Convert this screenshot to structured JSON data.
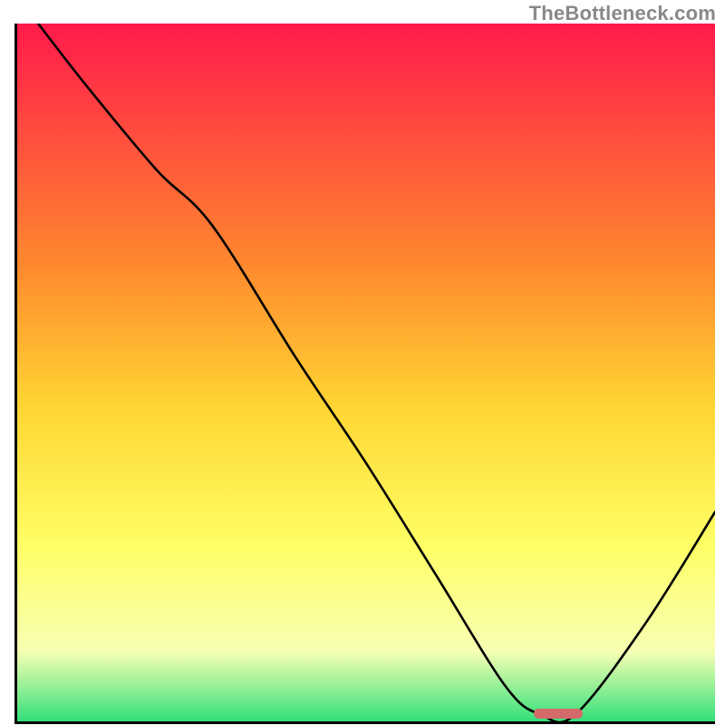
{
  "watermark": "TheBottleneck.com",
  "colors": {
    "gradient_top": "#ff1a4b",
    "gradient_mid1": "#ff8a2e",
    "gradient_mid2": "#ffd633",
    "gradient_mid3": "#ffff66",
    "gradient_mid4": "#f7ffb3",
    "gradient_bottom": "#33e07a",
    "axis": "#000000",
    "curve": "#000000",
    "marker": "#d46a6a"
  },
  "chart_data": {
    "type": "line",
    "title": "",
    "xlabel": "",
    "ylabel": "",
    "xlim": [
      0,
      100
    ],
    "ylim": [
      0,
      100
    ],
    "grid": false,
    "legend": false,
    "notes": "Bottleneck-style curve. Vertical gradient depicts score: top=red (bad), bottom=green (good). Black curve is bottleneck % vs an unlabeled x-axis. No axis ticks or labels shown.",
    "series": [
      {
        "name": "curve",
        "x": [
          3,
          10,
          20,
          28,
          40,
          50,
          60,
          70,
          75,
          80,
          90,
          100
        ],
        "values": [
          100,
          91,
          79,
          71,
          52,
          37,
          21,
          5,
          1,
          1,
          14,
          30
        ]
      }
    ],
    "marker": {
      "x_start": 74,
      "x_end": 81,
      "y": 1.2
    }
  }
}
